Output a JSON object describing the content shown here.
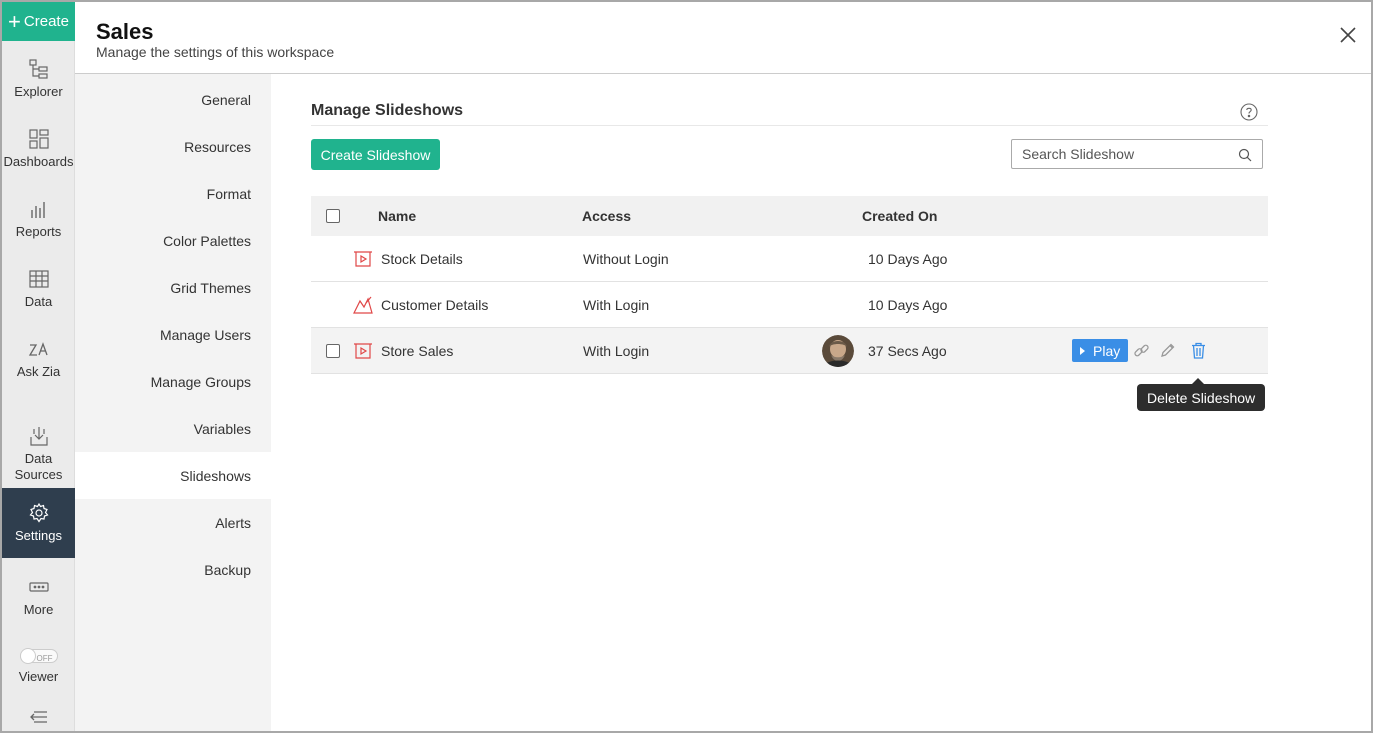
{
  "rail": {
    "create_label": "Create",
    "items": [
      {
        "label": "Explorer",
        "icon": "explorer-icon"
      },
      {
        "label": "Dashboards",
        "icon": "dashboards-icon"
      },
      {
        "label": "Reports",
        "icon": "reports-icon"
      },
      {
        "label": "Data",
        "icon": "data-icon"
      },
      {
        "label": "Ask Zia",
        "icon": "ask-zia-icon"
      },
      {
        "label": "Data Sources",
        "icon": "data-sources-icon"
      },
      {
        "label": "Settings",
        "icon": "gear-icon",
        "active": true
      },
      {
        "label": "More",
        "icon": "more-icon"
      },
      {
        "label": "Viewer",
        "icon": "toggle-icon",
        "toggle_state": "OFF"
      }
    ],
    "collapse_icon": "collapse-icon"
  },
  "header": {
    "title": "Sales",
    "subtitle": "Manage the settings of this workspace",
    "close_icon": "close-icon"
  },
  "settings_nav": {
    "items": [
      {
        "label": "General"
      },
      {
        "label": "Resources"
      },
      {
        "label": "Format"
      },
      {
        "label": "Color Palettes"
      },
      {
        "label": "Grid Themes"
      },
      {
        "label": "Manage Users"
      },
      {
        "label": "Manage Groups"
      },
      {
        "label": "Variables"
      },
      {
        "label": "Slideshows",
        "active": true
      },
      {
        "label": "Alerts"
      },
      {
        "label": "Backup"
      }
    ]
  },
  "main": {
    "section_title": "Manage Slideshows",
    "help_icon": "help-icon",
    "create_button": "Create Slideshow",
    "search": {
      "placeholder": "Search Slideshow",
      "value": ""
    },
    "table": {
      "columns": [
        "Name",
        "Access",
        "Created On"
      ],
      "rows": [
        {
          "name": "Stock Details",
          "access": "Without Login",
          "created_on": "10 Days Ago",
          "icon": "slideshow-icon"
        },
        {
          "name": "Customer Details",
          "access": "With Login",
          "created_on": "10 Days Ago",
          "icon": "chart-slideshow-icon"
        },
        {
          "name": "Store Sales",
          "access": "With Login",
          "created_on": "37 Secs Ago",
          "icon": "slideshow-icon",
          "hovered": true
        }
      ]
    },
    "row_actions": {
      "play_label": "Play",
      "link_icon": "link-icon",
      "edit_icon": "pencil-icon",
      "delete_icon": "trash-icon"
    },
    "tooltip": "Delete Slideshow"
  },
  "colors": {
    "accent_green": "#20b38e",
    "play_blue": "#3a8ee6",
    "rail_active": "#2f3e4e",
    "slideshow_icon_red": "#e04848"
  }
}
